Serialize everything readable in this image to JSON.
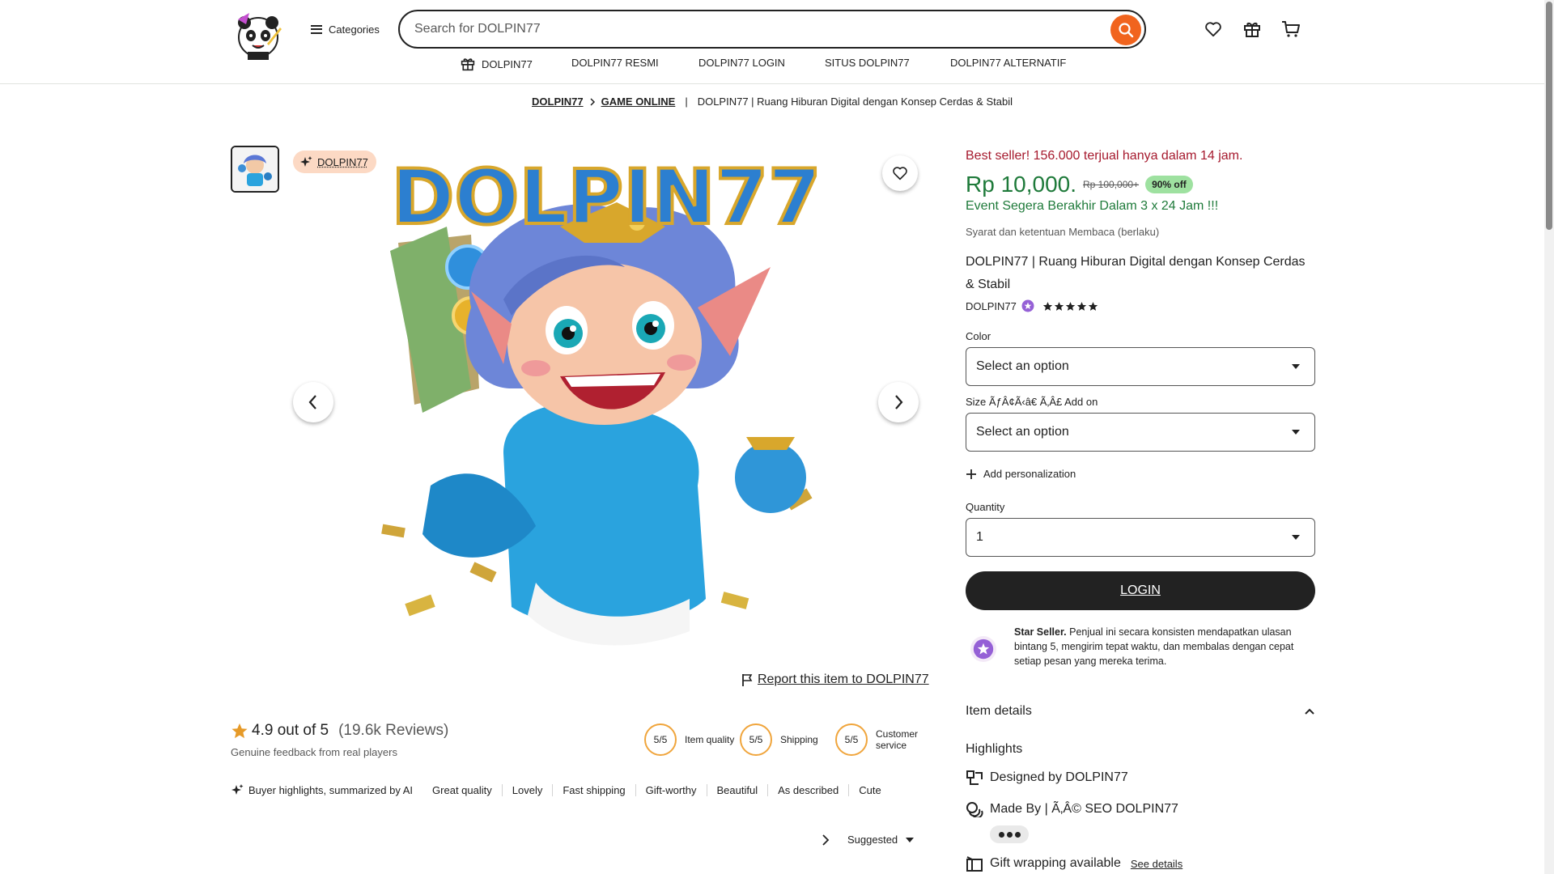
{
  "header": {
    "categories_label": "Categories",
    "search_placeholder": "Search for DOLPIN77"
  },
  "nav": {
    "items": [
      "DOLPIN77",
      "DOLPIN77 RESMI",
      "DOLPIN77 LOGIN",
      "SITUS DOLPIN77",
      "DOLPIN77 ALTERNATIF"
    ]
  },
  "breadcrumb": {
    "items": [
      "DOLPIN77",
      "GAME ONLINE"
    ],
    "separator": "|",
    "current": "DOLPIN77 | Ruang Hiburan Digital dengan Konsep Cerdas & Stabil"
  },
  "gallery": {
    "badge": "DOLPIN77",
    "image_title": "DOLPIN77",
    "report_label": "Report this item to DOLPIN77"
  },
  "reviews": {
    "rating_text": "4.9 out of 5",
    "count_text": "(19.6k Reviews)",
    "subtitle": "Genuine feedback from real players",
    "scores": [
      {
        "value": "5/5",
        "label": "Item quality"
      },
      {
        "value": "5/5",
        "label": "Shipping"
      },
      {
        "value": "5/5",
        "label": "Customer service"
      }
    ],
    "ai_label": "Buyer highlights, summarized by AI",
    "tags": [
      "Great quality",
      "Lovely",
      "Fast shipping",
      "Gift-worthy",
      "Beautiful",
      "As described",
      "Cute"
    ],
    "sort_label": "Suggested"
  },
  "product": {
    "best_seller": "Best seller! 156.000 terjual hanya dalam 14 jam.",
    "price": "Rp 10,000.",
    "old_price": "Rp 100,000+",
    "discount": "90% off",
    "event": "Event Segera Berakhir Dalam 3 x 24 Jam !!!",
    "terms": "Syarat dan ketentuan Membaca (berlaku)",
    "title": "DOLPIN77 | Ruang Hiburan Digital dengan Konsep Cerdas & Stabil",
    "shop_name": "DOLPIN77",
    "star_rating": 5,
    "color_label": "Color",
    "color_value": "Select an option",
    "size_label": "Size ÃƒÂ¢Ã‹â€ Ã‚Â£ Add on",
    "size_value": "Select an option",
    "personalization": "Add personalization",
    "quantity_label": "Quantity",
    "quantity_value": "1",
    "login_button": "LOGIN",
    "star_seller_title": "Star Seller.",
    "star_seller_text": "Penjual ini secara konsisten mendapatkan ulasan bintang 5, mengirim tepat waktu, dan membalas dengan cepat setiap pesan yang mereka terima.",
    "item_details": "Item details",
    "highlights_title": "Highlights",
    "highlight_designed": "Designed by DOLPIN77",
    "highlight_made": "Made By | Ã‚Â© SEO DOLPIN77",
    "highlight_gift": "Gift wrapping available",
    "see_details": "See details"
  },
  "colors": {
    "accent_orange": "#f1641e",
    "price_green": "#1e7a3a",
    "bestseller_red": "#a61a2e",
    "discount_bg": "#9ee1a0",
    "star_seller_purple": "#9560d6"
  }
}
